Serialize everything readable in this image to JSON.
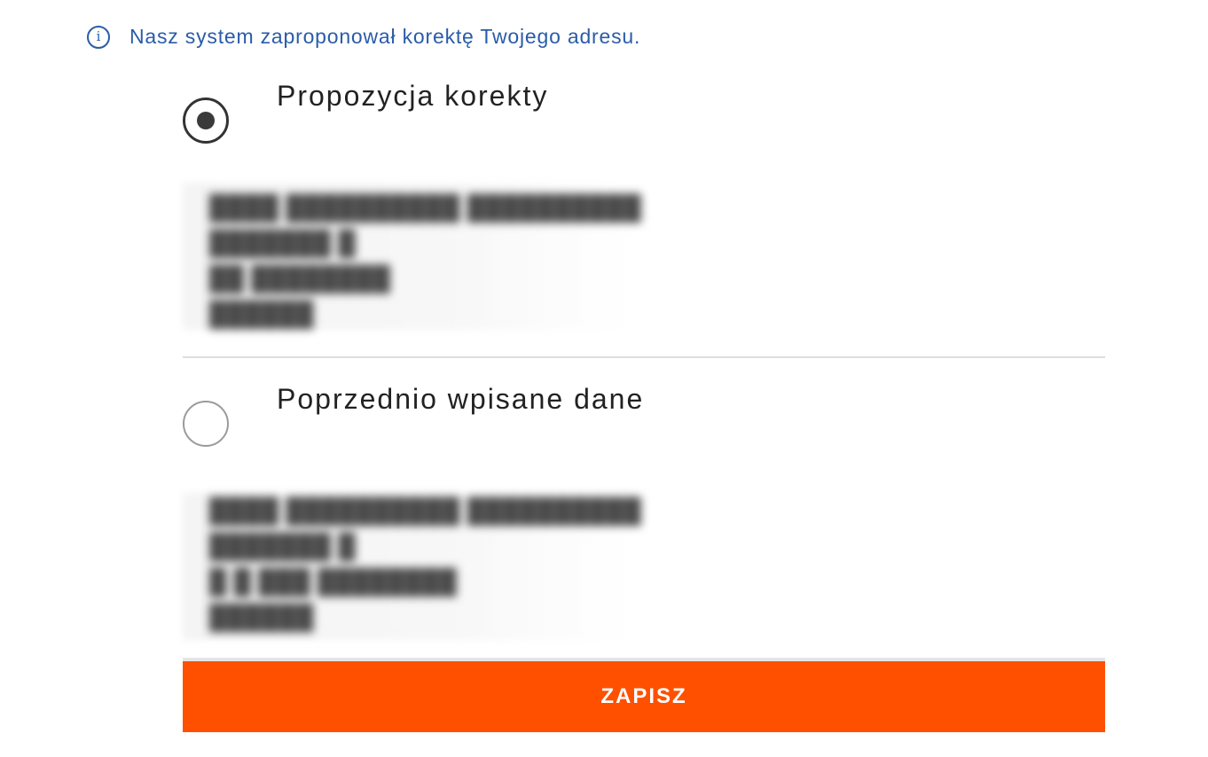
{
  "colors": {
    "accent": "#2a5ca8",
    "brand": "#ff5000"
  },
  "notice": {
    "icon": "info-icon",
    "text": "Nasz system zaproponował korektę Twojego adresu."
  },
  "options": [
    {
      "title": "Propozycja korekty",
      "selected": true
    },
    {
      "title": "Poprzednio wpisane dane",
      "selected": false
    }
  ],
  "save_button": {
    "label": "ZAPISZ"
  }
}
